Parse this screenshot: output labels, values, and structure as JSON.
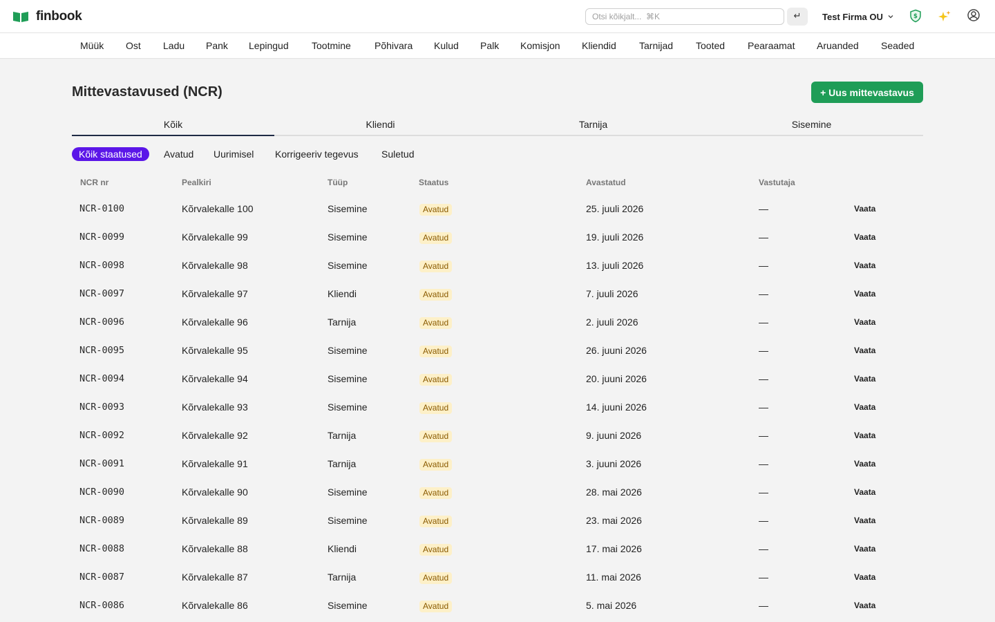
{
  "app": {
    "name": "finbook",
    "search_placeholder": "Otsi kõikjalt...  ⌘K",
    "enter_symbol": "↵",
    "company": "Test Firma OU"
  },
  "nav": [
    "Müük",
    "Ost",
    "Ladu",
    "Pank",
    "Lepingud",
    "Tootmine",
    "Põhivara",
    "Kulud",
    "Palk",
    "Komisjon",
    "Kliendid",
    "Tarnijad",
    "Tooted",
    "Pearaamat",
    "Aruanded",
    "Seaded"
  ],
  "page": {
    "title": "Mittevastavused (NCR)",
    "new_button": "+ Uus mittevastavus"
  },
  "tabs": [
    "Kõik",
    "Kliendi",
    "Tarnija",
    "Sisemine"
  ],
  "status_filters": [
    "Kõik staatused",
    "Avatud",
    "Uurimisel",
    "Korrigeeriv tegevus",
    "Suletud"
  ],
  "table": {
    "columns": [
      "NCR nr",
      "Pealkiri",
      "Tüüp",
      "Staatus",
      "Avastatud",
      "Vastutaja"
    ],
    "action_label": "Vaata",
    "rows": [
      {
        "nr": "NCR-0100",
        "title": "Kõrvalekalle 100",
        "type": "Sisemine",
        "status": "Avatud",
        "date": "25. juuli 2026",
        "owner": "—"
      },
      {
        "nr": "NCR-0099",
        "title": "Kõrvalekalle 99",
        "type": "Sisemine",
        "status": "Avatud",
        "date": "19. juuli 2026",
        "owner": "—"
      },
      {
        "nr": "NCR-0098",
        "title": "Kõrvalekalle 98",
        "type": "Sisemine",
        "status": "Avatud",
        "date": "13. juuli 2026",
        "owner": "—"
      },
      {
        "nr": "NCR-0097",
        "title": "Kõrvalekalle 97",
        "type": "Kliendi",
        "status": "Avatud",
        "date": "7. juuli 2026",
        "owner": "—"
      },
      {
        "nr": "NCR-0096",
        "title": "Kõrvalekalle 96",
        "type": "Tarnija",
        "status": "Avatud",
        "date": "2. juuli 2026",
        "owner": "—"
      },
      {
        "nr": "NCR-0095",
        "title": "Kõrvalekalle 95",
        "type": "Sisemine",
        "status": "Avatud",
        "date": "26. juuni 2026",
        "owner": "—"
      },
      {
        "nr": "NCR-0094",
        "title": "Kõrvalekalle 94",
        "type": "Sisemine",
        "status": "Avatud",
        "date": "20. juuni 2026",
        "owner": "—"
      },
      {
        "nr": "NCR-0093",
        "title": "Kõrvalekalle 93",
        "type": "Sisemine",
        "status": "Avatud",
        "date": "14. juuni 2026",
        "owner": "—"
      },
      {
        "nr": "NCR-0092",
        "title": "Kõrvalekalle 92",
        "type": "Tarnija",
        "status": "Avatud",
        "date": "9. juuni 2026",
        "owner": "—"
      },
      {
        "nr": "NCR-0091",
        "title": "Kõrvalekalle 91",
        "type": "Tarnija",
        "status": "Avatud",
        "date": "3. juuni 2026",
        "owner": "—"
      },
      {
        "nr": "NCR-0090",
        "title": "Kõrvalekalle 90",
        "type": "Sisemine",
        "status": "Avatud",
        "date": "28. mai 2026",
        "owner": "—"
      },
      {
        "nr": "NCR-0089",
        "title": "Kõrvalekalle 89",
        "type": "Sisemine",
        "status": "Avatud",
        "date": "23. mai 2026",
        "owner": "—"
      },
      {
        "nr": "NCR-0088",
        "title": "Kõrvalekalle 88",
        "type": "Kliendi",
        "status": "Avatud",
        "date": "17. mai 2026",
        "owner": "—"
      },
      {
        "nr": "NCR-0087",
        "title": "Kõrvalekalle 87",
        "type": "Tarnija",
        "status": "Avatud",
        "date": "11. mai 2026",
        "owner": "—"
      },
      {
        "nr": "NCR-0086",
        "title": "Kõrvalekalle 86",
        "type": "Sisemine",
        "status": "Avatud",
        "date": "5. mai 2026",
        "owner": "—"
      }
    ]
  },
  "colors": {
    "brand_green": "#1f9d57",
    "active_filter": "#5b16e8",
    "status_badge_bg": "#fdf0c8",
    "status_badge_text": "#8a5a00"
  },
  "icons": {
    "logo": "open-book-icon",
    "chevron": "chevron-down-icon",
    "shield": "shield-dollar-icon",
    "sparkle": "sparkles-icon",
    "user": "user-circle-icon"
  }
}
